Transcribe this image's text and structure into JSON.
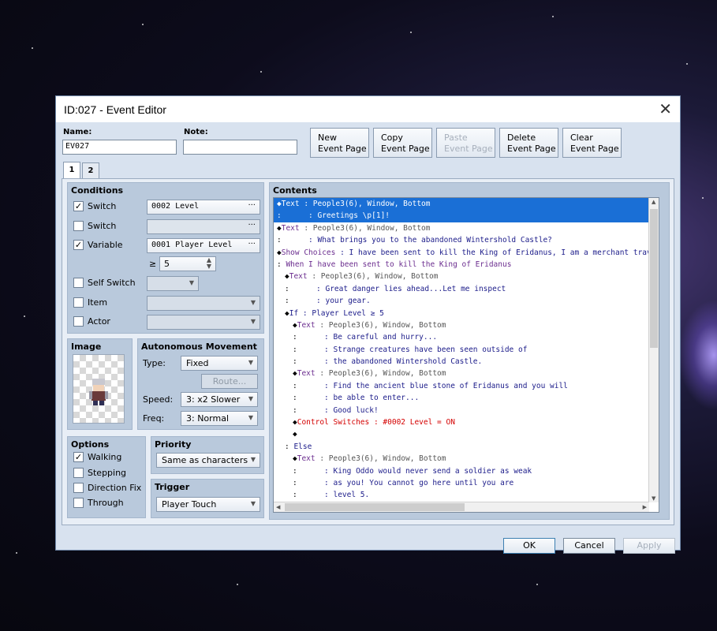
{
  "window": {
    "title": "ID:027 - Event Editor"
  },
  "name": {
    "label": "Name:",
    "value": "EV027"
  },
  "note": {
    "label": "Note:",
    "value": ""
  },
  "toolbar": {
    "new": [
      "New",
      "Event Page"
    ],
    "copy": [
      "Copy",
      "Event Page"
    ],
    "paste": [
      "Paste",
      "Event Page"
    ],
    "delete": [
      "Delete",
      "Event Page"
    ],
    "clear": [
      "Clear",
      "Event Page"
    ]
  },
  "tabs": [
    "1",
    "2"
  ],
  "conditions": {
    "title": "Conditions",
    "switch1": {
      "label": "Switch",
      "checked": true,
      "value": "0002 Level"
    },
    "switch2": {
      "label": "Switch",
      "checked": false,
      "value": ""
    },
    "variable": {
      "label": "Variable",
      "checked": true,
      "value": "0001 Player Level",
      "op": "≥",
      "amount": "5"
    },
    "self_switch": {
      "label": "Self Switch",
      "checked": false
    },
    "item": {
      "label": "Item",
      "checked": false
    },
    "actor": {
      "label": "Actor",
      "checked": false
    }
  },
  "image": {
    "title": "Image"
  },
  "autonomous": {
    "title": "Autonomous Movement",
    "type_label": "Type:",
    "type_value": "Fixed",
    "route_label": "Route...",
    "speed_label": "Speed:",
    "speed_value": "3: x2 Slower",
    "freq_label": "Freq:",
    "freq_value": "3: Normal"
  },
  "options": {
    "title": "Options",
    "walking": {
      "label": "Walking",
      "checked": true
    },
    "stepping": {
      "label": "Stepping",
      "checked": false
    },
    "direction_fix": {
      "label": "Direction Fix",
      "checked": false
    },
    "through": {
      "label": "Through",
      "checked": false
    }
  },
  "priority": {
    "title": "Priority",
    "value": "Same as characters"
  },
  "trigger": {
    "title": "Trigger",
    "value": "Player Touch"
  },
  "contents": {
    "title": "Contents",
    "rows": [
      {
        "indent": 0,
        "prefix": "◆",
        "cmd": "Text",
        "cls": "cmd",
        "rest": " : People3(6), Window, Bottom",
        "restcls": "gray",
        "selected": true
      },
      {
        "indent": 0,
        "prefix": ":",
        "cmd": "",
        "cls": "",
        "rest": "      : Greetings \\p[1]!",
        "restcls": "",
        "selected": true
      },
      {
        "indent": 0,
        "prefix": "◆",
        "cmd": "Text",
        "cls": "cmd-purple",
        "rest": " : People3(6), Window, Bottom",
        "restcls": "gray"
      },
      {
        "indent": 0,
        "prefix": ":",
        "cmd": "",
        "cls": "",
        "rest": "      : What brings you to the abandoned Wintershold Castle?",
        "restcls": ""
      },
      {
        "indent": 0,
        "prefix": "◆",
        "cmd": "Show Choices",
        "cls": "cmd-purple",
        "rest": " : I have been sent to kill the King of Eridanus, I am a merchant traveling t",
        "restcls": ""
      },
      {
        "indent": 0,
        "prefix": ":",
        "cmd": "",
        "cls": "",
        "rest": " When I have been sent to kill the King of Eridanus",
        "restcls": "cmd-purple"
      },
      {
        "indent": 1,
        "prefix": "◆",
        "cmd": "Text",
        "cls": "cmd-purple",
        "rest": " : People3(6), Window, Bottom",
        "restcls": "gray"
      },
      {
        "indent": 1,
        "prefix": ":",
        "cmd": "",
        "cls": "",
        "rest": "      : Great danger lies ahead...Let me inspect",
        "restcls": ""
      },
      {
        "indent": 1,
        "prefix": ":",
        "cmd": "",
        "cls": "",
        "rest": "      : your gear.",
        "restcls": ""
      },
      {
        "indent": 1,
        "prefix": "◆",
        "cmd": "If",
        "cls": "",
        "rest": " : Player Level ≥ 5",
        "restcls": ""
      },
      {
        "indent": 2,
        "prefix": "◆",
        "cmd": "Text",
        "cls": "cmd-purple",
        "rest": " : People3(6), Window, Bottom",
        "restcls": "gray"
      },
      {
        "indent": 2,
        "prefix": ":",
        "cmd": "",
        "cls": "",
        "rest": "      : Be careful and hurry...",
        "restcls": ""
      },
      {
        "indent": 2,
        "prefix": ":",
        "cmd": "",
        "cls": "",
        "rest": "      : Strange creatures have been seen outside of",
        "restcls": ""
      },
      {
        "indent": 2,
        "prefix": ":",
        "cmd": "",
        "cls": "",
        "rest": "      : the abandoned Wintershold Castle.",
        "restcls": ""
      },
      {
        "indent": 2,
        "prefix": "◆",
        "cmd": "Text",
        "cls": "cmd-purple",
        "rest": " : People3(6), Window, Bottom",
        "restcls": "gray"
      },
      {
        "indent": 2,
        "prefix": ":",
        "cmd": "",
        "cls": "",
        "rest": "      : Find the ancient blue stone of Eridanus and you will",
        "restcls": ""
      },
      {
        "indent": 2,
        "prefix": ":",
        "cmd": "",
        "cls": "",
        "rest": "      : be able to enter...",
        "restcls": ""
      },
      {
        "indent": 2,
        "prefix": ":",
        "cmd": "",
        "cls": "",
        "rest": "      : Good luck!",
        "restcls": ""
      },
      {
        "indent": 2,
        "prefix": "◆",
        "cmd": "Control Switches",
        "cls": "cmd-red",
        "rest": " : #0002 Level = ON",
        "restcls": "cmd-red"
      },
      {
        "indent": 2,
        "prefix": "◆",
        "cmd": "",
        "cls": "",
        "rest": "",
        "restcls": ""
      },
      {
        "indent": 1,
        "prefix": ":",
        "cmd": "",
        "cls": "",
        "rest": " Else",
        "restcls": ""
      },
      {
        "indent": 2,
        "prefix": "◆",
        "cmd": "Text",
        "cls": "cmd-purple",
        "rest": " : People3(6), Window, Bottom",
        "restcls": "gray"
      },
      {
        "indent": 2,
        "prefix": ":",
        "cmd": "",
        "cls": "",
        "rest": "      : King Oddo would never send a soldier as weak",
        "restcls": ""
      },
      {
        "indent": 2,
        "prefix": ":",
        "cmd": "",
        "cls": "",
        "rest": "      : as you! You cannot go here until you are",
        "restcls": ""
      },
      {
        "indent": 2,
        "prefix": ":",
        "cmd": "",
        "cls": "",
        "rest": "      : level 5.",
        "restcls": ""
      }
    ]
  },
  "buttons": {
    "ok": "OK",
    "cancel": "Cancel",
    "apply": "Apply"
  },
  "icons": {
    "close": "close-icon",
    "dropdown": "chevron-down-icon",
    "browse": "ellipsis-icon"
  }
}
